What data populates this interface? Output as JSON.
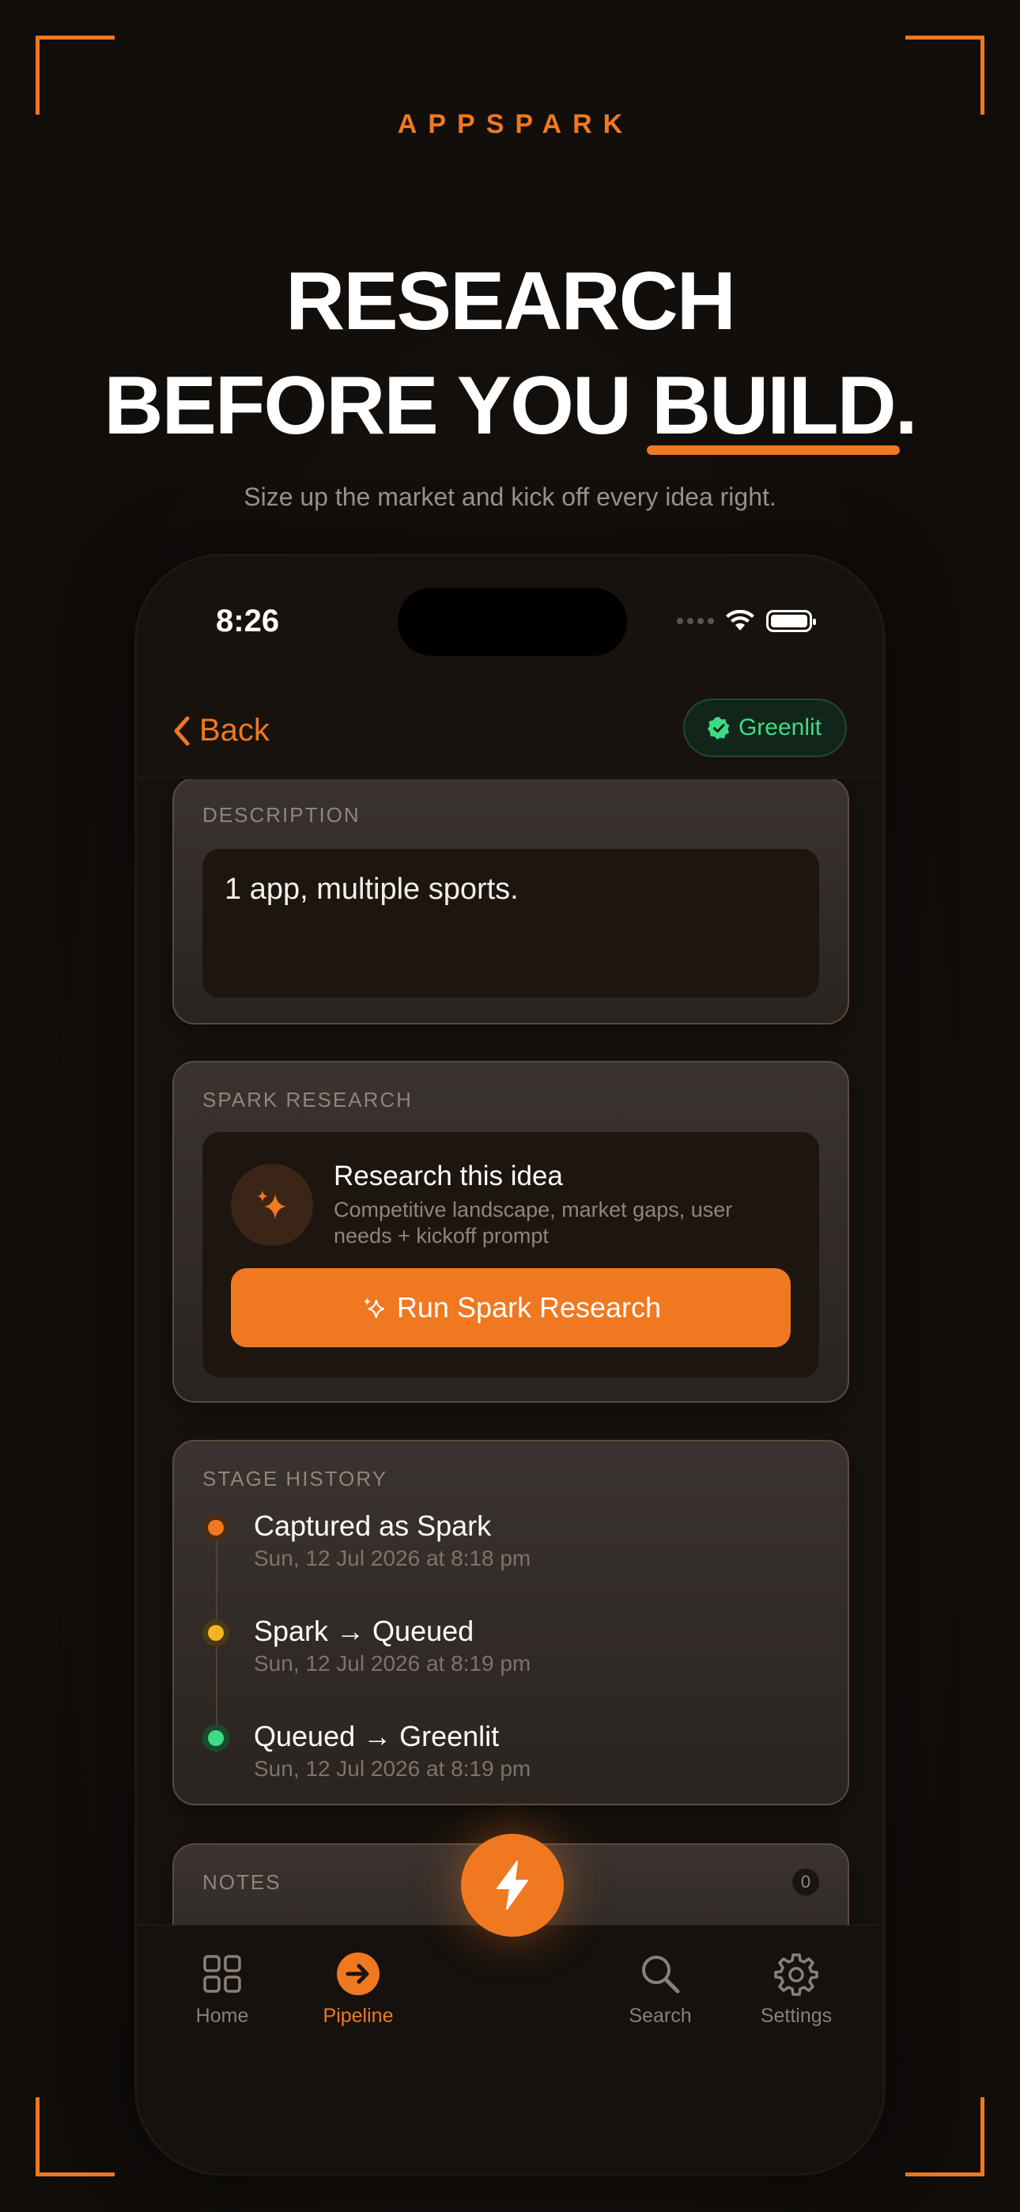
{
  "brand": "APPSPARK",
  "headline": {
    "line1": "RESEARCH",
    "line2_prefix": "BEFORE YOU ",
    "line2_accent": "BUILD",
    "line2_suffix": "."
  },
  "subtitle": "Size up the market and kick off every idea right.",
  "status_bar": {
    "time": "8:26"
  },
  "nav": {
    "back_label": "Back",
    "badge_label": "Greenlit"
  },
  "description": {
    "label": "DESCRIPTION",
    "value": "1 app, multiple sports."
  },
  "spark_research": {
    "label": "SPARK RESEARCH",
    "title": "Research this idea",
    "desc": "Competitive landscape, market gaps, user needs + kickoff prompt",
    "button_label": "Run Spark Research"
  },
  "stage_history": {
    "label": "STAGE HISTORY",
    "events": [
      {
        "title": "Captured as Spark",
        "date": "Sun, 12 Jul 2026 at 8:18 pm",
        "color": "#f07820"
      },
      {
        "title": "Spark → Queued",
        "date": "Sun, 12 Jul 2026 at 8:19 pm",
        "color": "#f5b324"
      },
      {
        "title": "Queued → Greenlit",
        "date": "Sun, 12 Jul 2026 at 8:19 pm",
        "color": "#3ddc84"
      }
    ]
  },
  "notes": {
    "label": "NOTES",
    "count": "0"
  },
  "tabs": [
    {
      "label": "Home",
      "icon": "grid-icon"
    },
    {
      "label": "Pipeline",
      "icon": "arrow-circle-icon"
    },
    {
      "label": "Search",
      "icon": "search-icon"
    },
    {
      "label": "Settings",
      "icon": "gear-icon"
    }
  ],
  "colors": {
    "accent": "#f07820",
    "success": "#3ddc84",
    "warning": "#f5b324"
  }
}
